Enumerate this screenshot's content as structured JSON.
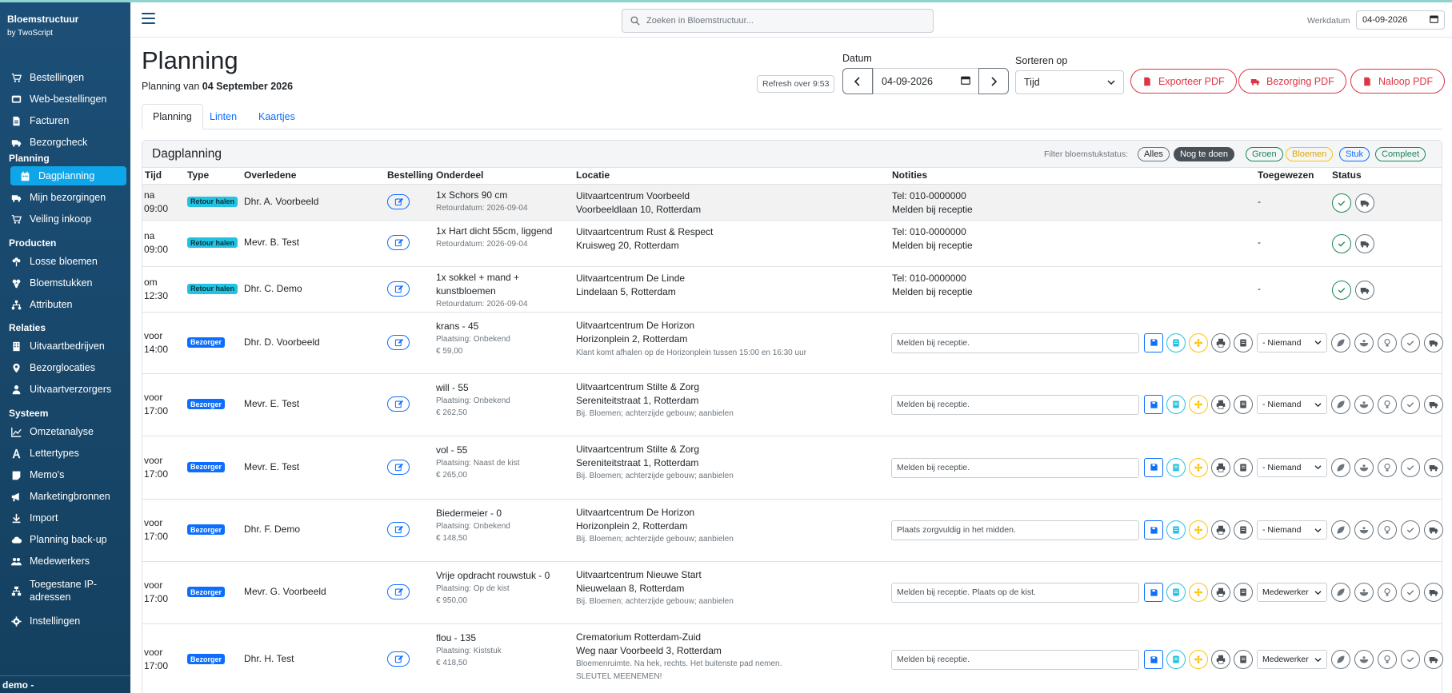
{
  "app": {
    "title": "Bloemstructuur",
    "subtitle": "by TwoScript",
    "user": "demo -"
  },
  "nav": {
    "main": [
      {
        "label": "Bestellingen",
        "icon": "cart-icon"
      },
      {
        "label": "Web-bestellingen",
        "icon": "web-icon"
      },
      {
        "label": "Facturen",
        "icon": "invoice-icon"
      },
      {
        "label": "Bezorgcheck",
        "icon": "truck-icon"
      }
    ],
    "planning_header": "Planning",
    "planning": [
      {
        "label": "Dagplanning",
        "icon": "calendar-icon",
        "active": true
      },
      {
        "label": "Mijn bezorgingen",
        "icon": "truck-icon"
      },
      {
        "label": "Veiling inkoop",
        "icon": "cart-icon"
      }
    ],
    "producten_header": "Producten",
    "producten": [
      {
        "label": "Losse bloemen",
        "icon": "flower-icon"
      },
      {
        "label": "Bloemstukken",
        "icon": "bouquet-icon"
      },
      {
        "label": "Attributen",
        "icon": "sitemap-icon"
      }
    ],
    "relaties_header": "Relaties",
    "relaties": [
      {
        "label": "Uitvaartbedrijven",
        "icon": "building-icon"
      },
      {
        "label": "Bezorglocaties",
        "icon": "map-pin-icon"
      },
      {
        "label": "Uitvaartverzorgers",
        "icon": "user-icon"
      }
    ],
    "systeem_header": "Systeem",
    "systeem": [
      {
        "label": "Omzetanalyse",
        "icon": "chart-icon"
      },
      {
        "label": "Lettertypes",
        "icon": "font-icon"
      },
      {
        "label": "Memo's",
        "icon": "memo-icon"
      },
      {
        "label": "Marketingbronnen",
        "icon": "megaphone-icon"
      },
      {
        "label": "Import",
        "icon": "import-icon"
      },
      {
        "label": "Planning back-up",
        "icon": "cloud-icon"
      },
      {
        "label": "Medewerkers",
        "icon": "users-icon"
      },
      {
        "label": "Toegestane IP-adressen",
        "icon": "network-icon"
      },
      {
        "label": "Instellingen",
        "icon": "gear-icon"
      }
    ]
  },
  "topbar": {
    "search_placeholder": "Zoeken in Bloemstructuur...",
    "werkdatum_label": "Werkdatum",
    "werkdatum": "04-09-2026"
  },
  "header": {
    "title": "Planning",
    "subtitle_prefix": "Planning van",
    "subtitle_date": "04 September 2026",
    "refresh": "Refresh over 9:53",
    "datum_label": "Datum",
    "datum": "04-09-2026",
    "sort_label": "Sorteren op",
    "sort_value": "Tijd",
    "export_pdf": "Exporteer PDF",
    "bezorging_pdf": "Bezorging PDF",
    "naloop_pdf": "Naloop PDF"
  },
  "tabs": [
    "Planning",
    "Linten",
    "Kaartjes"
  ],
  "card": {
    "title": "Dagplanning",
    "filter_label": "Filter bloemstukstatus:",
    "filters": [
      {
        "label": "Alles",
        "color": "#6c757d"
      },
      {
        "label": "Nog te doen",
        "color": "#495057"
      },
      {
        "label": "Groen",
        "color": "#198754"
      },
      {
        "label": "Bloemen",
        "color": "#ffc107"
      },
      {
        "label": "Stuk",
        "color": "#0d6efd"
      },
      {
        "label": "Compleet",
        "color": "#198754"
      }
    ]
  },
  "columns": [
    "Tijd",
    "Type",
    "Overledene",
    "Bestelling",
    "Onderdeel",
    "Locatie",
    "Notities",
    "Toegewezen",
    "Status"
  ],
  "rows": [
    {
      "t1": "na",
      "t2": "09:00",
      "type": "Retour halen",
      "naam": "Dhr. A. Voorbeeld",
      "ond1": "1x Schors 90 cm",
      "ond2": "",
      "sub1": "Retourdatum: 2026-09-04",
      "sub2": "",
      "loc1": "Uitvaartcentrum Voorbeeld",
      "loc2": "Voorbeeldlaan 10, Rotterdam",
      "locnote": "",
      "locnote2": "",
      "not1": "Tel: 010-0000000",
      "not2": "Melden bij receptie",
      "toe": "-"
    },
    {
      "t1": "na",
      "t2": "09:00",
      "type": "Retour halen",
      "naam": "Mevr. B. Test",
      "ond1": "1x Hart dicht 55cm, liggend",
      "ond2": "",
      "sub1": "Retourdatum: 2026-09-04",
      "sub2": "",
      "loc1": "Uitvaartcentrum Rust & Respect",
      "loc2": "Kruisweg 20, Rotterdam",
      "locnote": "",
      "locnote2": "",
      "not1": "Tel: 010-0000000",
      "not2": "Melden bij receptie",
      "toe": "-"
    },
    {
      "t1": "om",
      "t2": "12:30",
      "type": "Retour halen",
      "naam": "Dhr. C. Demo",
      "ond1": "1x sokkel + mand +",
      "ond2": "kunstbloemen",
      "sub1": "Retourdatum: 2026-09-04",
      "sub2": "",
      "loc1": "Uitvaartcentrum De Linde",
      "loc2": "Lindelaan 5, Rotterdam",
      "locnote": "",
      "locnote2": "",
      "not1": "Tel: 010-0000000",
      "not2": "Melden bij receptie",
      "toe": "-"
    },
    {
      "t1": "voor",
      "t2": "14:00",
      "type": "Bezorger",
      "naam": "Dhr. D. Voorbeeld",
      "ond1": "krans - 45",
      "ond2": "",
      "sub1": "Plaatsing: Onbekend",
      "sub2": "€ 59,00",
      "loc1": "Uitvaartcentrum De Horizon",
      "loc2": "Horizonplein 2, Rotterdam",
      "locnote": "",
      "locnote2": "Klant komt afhalen op de Horizonplein tussen 15:00 en 16:30 uur",
      "note": "Melden bij receptie.",
      "toe": "- Niemand"
    },
    {
      "t1": "voor",
      "t2": "17:00",
      "type": "Bezorger",
      "naam": "Mevr. E. Test",
      "ond1": "will - 55",
      "ond2": "",
      "sub1": "Plaatsing: Onbekend",
      "sub2": "€ 262,50",
      "loc1": "Uitvaartcentrum Stilte & Zorg",
      "loc2": "Sereniteitstraat 1, Rotterdam",
      "locnote": "Bij. Bloemen; achterzijde gebouw; aanbielen",
      "locnote2": "",
      "note": "Melden bij receptie.",
      "toe": "- Niemand"
    },
    {
      "t1": "voor",
      "t2": "17:00",
      "type": "Bezorger",
      "naam": "Mevr. E. Test",
      "ond1": "vol - 55",
      "ond2": "",
      "sub1": "Plaatsing: Naast de kist",
      "sub2": "€ 265,00",
      "loc1": "Uitvaartcentrum Stilte & Zorg",
      "loc2": "Sereniteitstraat 1, Rotterdam",
      "locnote": "Bij. Bloemen; achterzijde gebouw; aanbielen",
      "locnote2": "",
      "note": "Melden bij receptie.",
      "toe": "- Niemand"
    },
    {
      "t1": "voor",
      "t2": "17:00",
      "type": "Bezorger",
      "naam": "Dhr. F. Demo",
      "ond1": "Biedermeier - 0",
      "ond2": "",
      "sub1": "Plaatsing: Onbekend",
      "sub2": "€ 148,50",
      "loc1": "Uitvaartcentrum De Horizon",
      "loc2": "Horizonplein 2, Rotterdam",
      "locnote": "Bij. Bloemen; achterzijde gebouw; aanbielen",
      "locnote2": "",
      "note": "Plaats zorgvuldig in het midden.",
      "toe": "- Niemand"
    },
    {
      "t1": "voor",
      "t2": "17:00",
      "type": "Bezorger",
      "naam": "Mevr. G. Voorbeeld",
      "ond1": "Vrije opdracht rouwstuk - 0",
      "ond2": "",
      "sub1": "Plaatsing: Op de kist",
      "sub2": "€ 950,00",
      "loc1": "Uitvaartcentrum Nieuwe Start",
      "loc2": "Nieuwelaan 8, Rotterdam",
      "locnote": "Bij. Bloemen; achterzijde gebouw; aanbielen",
      "locnote2": "",
      "note": "Melden bij receptie. Plaats op de kist.",
      "toe": "Medewerker"
    },
    {
      "t1": "voor",
      "t2": "17:00",
      "type": "Bezorger",
      "naam": "Dhr. H. Test",
      "ond1": "flou - 135",
      "ond2": "",
      "sub1": "Plaatsing: Kiststuk",
      "sub2": "€ 418,50",
      "loc1": "Crematorium Rotterdam-Zuid",
      "loc2": "Weg naar Voorbeeld 3, Rotterdam",
      "locnote": "Bloemenruimte. Na hek, rechts. Het buitenste pad nemen.",
      "locnote2": "SLEUTEL MEENEMEN!",
      "note": "Melden bij receptie.",
      "toe": "Medewerker"
    }
  ]
}
